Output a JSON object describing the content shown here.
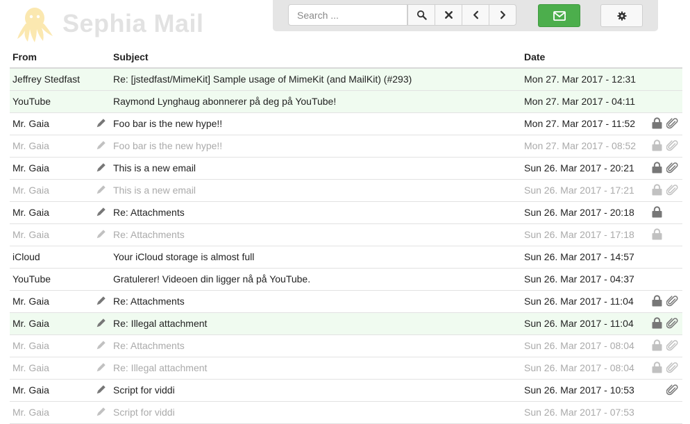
{
  "app": {
    "title": "Sephia Mail"
  },
  "search": {
    "placeholder": "Search ..."
  },
  "columns": {
    "from": "From",
    "subject": "Subject",
    "date": "Date"
  },
  "colors": {
    "accent": "#4cae4c",
    "unread_bg": "#f0fbf0",
    "logo": "#fbe8b0"
  },
  "emails": [
    {
      "from": "Jeffrey Stedfast",
      "subject": "Re: [jstedfast/MimeKit] Sample usage of MimeKit (and MailKit) (#293)",
      "date": "Mon 27. Mar 2017 - 12:31",
      "style": "unread",
      "draft": false,
      "locked": false,
      "attachment": false
    },
    {
      "from": "YouTube",
      "subject": "Raymond Lynghaug abonnerer på deg på YouTube!",
      "date": "Mon 27. Mar 2017 - 04:11",
      "style": "unread",
      "draft": false,
      "locked": false,
      "attachment": false
    },
    {
      "from": "Mr. Gaia",
      "subject": "Foo bar is the new hype!!",
      "date": "Mon 27. Mar 2017 - 11:52",
      "style": "normal",
      "draft": true,
      "locked": true,
      "attachment": true
    },
    {
      "from": "Mr. Gaia",
      "subject": "Foo bar is the new hype!!",
      "date": "Mon 27. Mar 2017 - 08:52",
      "style": "read",
      "draft": true,
      "locked": true,
      "attachment": true
    },
    {
      "from": "Mr. Gaia",
      "subject": "This is a new email",
      "date": "Sun 26. Mar 2017 - 20:21",
      "style": "normal",
      "draft": true,
      "locked": true,
      "attachment": true
    },
    {
      "from": "Mr. Gaia",
      "subject": "This is a new email",
      "date": "Sun 26. Mar 2017 - 17:21",
      "style": "read",
      "draft": true,
      "locked": true,
      "attachment": true
    },
    {
      "from": "Mr. Gaia",
      "subject": "Re: Attachments",
      "date": "Sun 26. Mar 2017 - 20:18",
      "style": "normal",
      "draft": true,
      "locked": true,
      "attachment": false
    },
    {
      "from": "Mr. Gaia",
      "subject": "Re: Attachments",
      "date": "Sun 26. Mar 2017 - 17:18",
      "style": "read",
      "draft": true,
      "locked": true,
      "attachment": false
    },
    {
      "from": "iCloud",
      "subject": "Your iCloud storage is almost full",
      "date": "Sun 26. Mar 2017 - 14:57",
      "style": "normal",
      "draft": false,
      "locked": false,
      "attachment": false
    },
    {
      "from": "YouTube",
      "subject": "Gratulerer! Videoen din ligger nå på YouTube.",
      "date": "Sun 26. Mar 2017 - 04:37",
      "style": "normal",
      "draft": false,
      "locked": false,
      "attachment": false
    },
    {
      "from": "Mr. Gaia",
      "subject": "Re: Attachments",
      "date": "Sun 26. Mar 2017 - 11:04",
      "style": "normal",
      "draft": true,
      "locked": true,
      "attachment": true
    },
    {
      "from": "Mr. Gaia",
      "subject": "Re: Illegal attachment",
      "date": "Sun 26. Mar 2017 - 11:04",
      "style": "unread",
      "draft": true,
      "locked": true,
      "attachment": true
    },
    {
      "from": "Mr. Gaia",
      "subject": "Re: Attachments",
      "date": "Sun 26. Mar 2017 - 08:04",
      "style": "read",
      "draft": true,
      "locked": true,
      "attachment": true
    },
    {
      "from": "Mr. Gaia",
      "subject": "Re: Illegal attachment",
      "date": "Sun 26. Mar 2017 - 08:04",
      "style": "read",
      "draft": true,
      "locked": true,
      "attachment": true
    },
    {
      "from": "Mr. Gaia",
      "subject": "Script for viddi",
      "date": "Sun 26. Mar 2017 - 10:53",
      "style": "normal",
      "draft": true,
      "locked": false,
      "attachment": true
    },
    {
      "from": "Mr. Gaia",
      "subject": "Script for viddi",
      "date": "Sun 26. Mar 2017 - 07:53",
      "style": "read",
      "draft": true,
      "locked": false,
      "attachment": false
    }
  ]
}
